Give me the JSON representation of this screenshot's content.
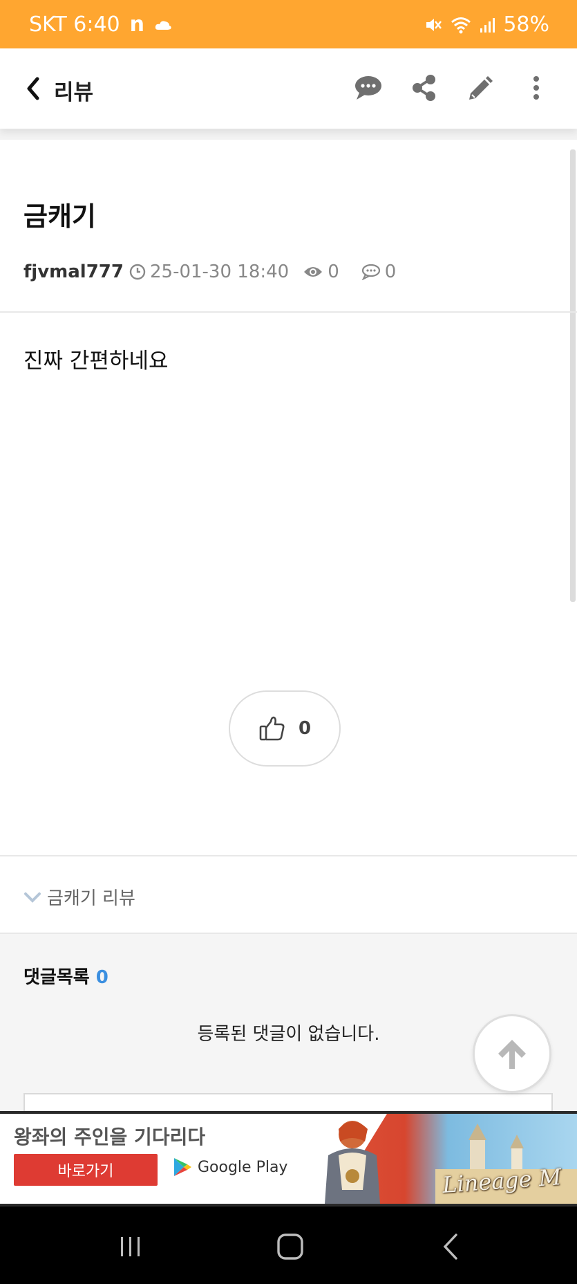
{
  "status_bar": {
    "carrier_time": "SKT 6:40",
    "notification_icon": "n",
    "battery": "58%",
    "color": "#ffa630"
  },
  "header": {
    "title": "리뷰",
    "icons": [
      "back-icon",
      "comment-icon",
      "share-icon",
      "edit-icon",
      "more-vertical-icon"
    ]
  },
  "post": {
    "title": "금캐기",
    "author": "fjvmal777",
    "datetime": "25-01-30 18:40",
    "views": "0",
    "comment_count": "0",
    "body": "진짜 간편하네요",
    "likes": "0"
  },
  "category_link": "금캐기 리뷰",
  "comments": {
    "title": "댓글목록",
    "count": "0",
    "empty_text": "등록된 댓글이 없습니다.",
    "count_color": "#3b8fe0"
  },
  "ad": {
    "headline": "왕좌의 주인을 기다리다",
    "cta": "바로가기",
    "store": "Google Play",
    "logo_text": "Lineage M"
  },
  "nav_bar": {
    "icons": [
      "recent-apps-icon",
      "home-icon",
      "back-nav-icon"
    ]
  }
}
